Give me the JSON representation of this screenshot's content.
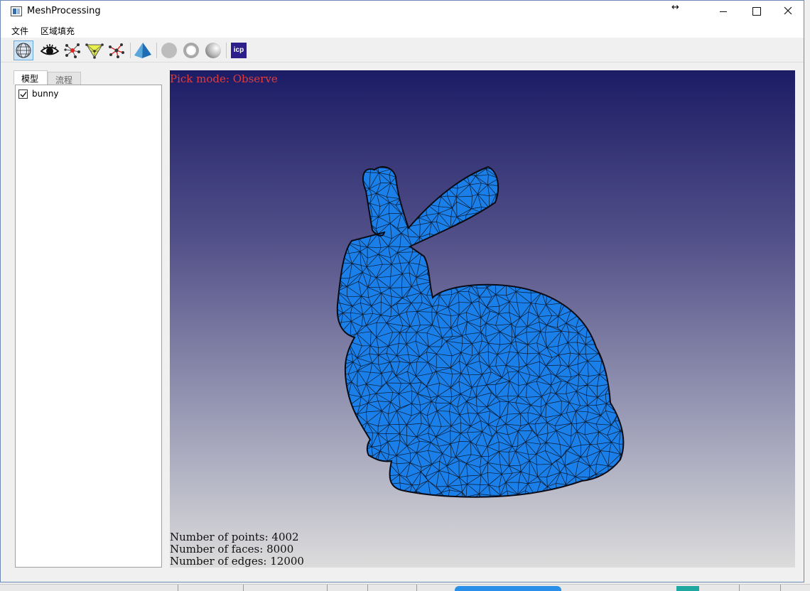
{
  "window": {
    "title": "MeshProcessing",
    "resize_hint": "↔"
  },
  "menu": {
    "file": "文件",
    "region_fill": "区域填充"
  },
  "toolbar": {
    "icons": [
      "wireframe-sphere-icon",
      "eye-icon",
      "vertex-graph-icon",
      "face-select-icon",
      "edge-graph-icon",
      "pyramid-icon",
      "flat-sphere-icon",
      "ring-icon",
      "smooth-sphere-icon",
      "icp-icon"
    ],
    "icp_label": "icp"
  },
  "left_panel": {
    "tabs": [
      {
        "label": "模型"
      },
      {
        "label": "流程"
      }
    ],
    "models": [
      {
        "name": "bunny",
        "checked": true
      }
    ]
  },
  "viewport": {
    "pick_mode": "Pick mode: Observe",
    "stats": {
      "points": "Number of points: 4002",
      "faces": "Number of faces: 8000",
      "edges": "Number of edges: 12000"
    },
    "mesh_color": "#1a7fe8"
  }
}
